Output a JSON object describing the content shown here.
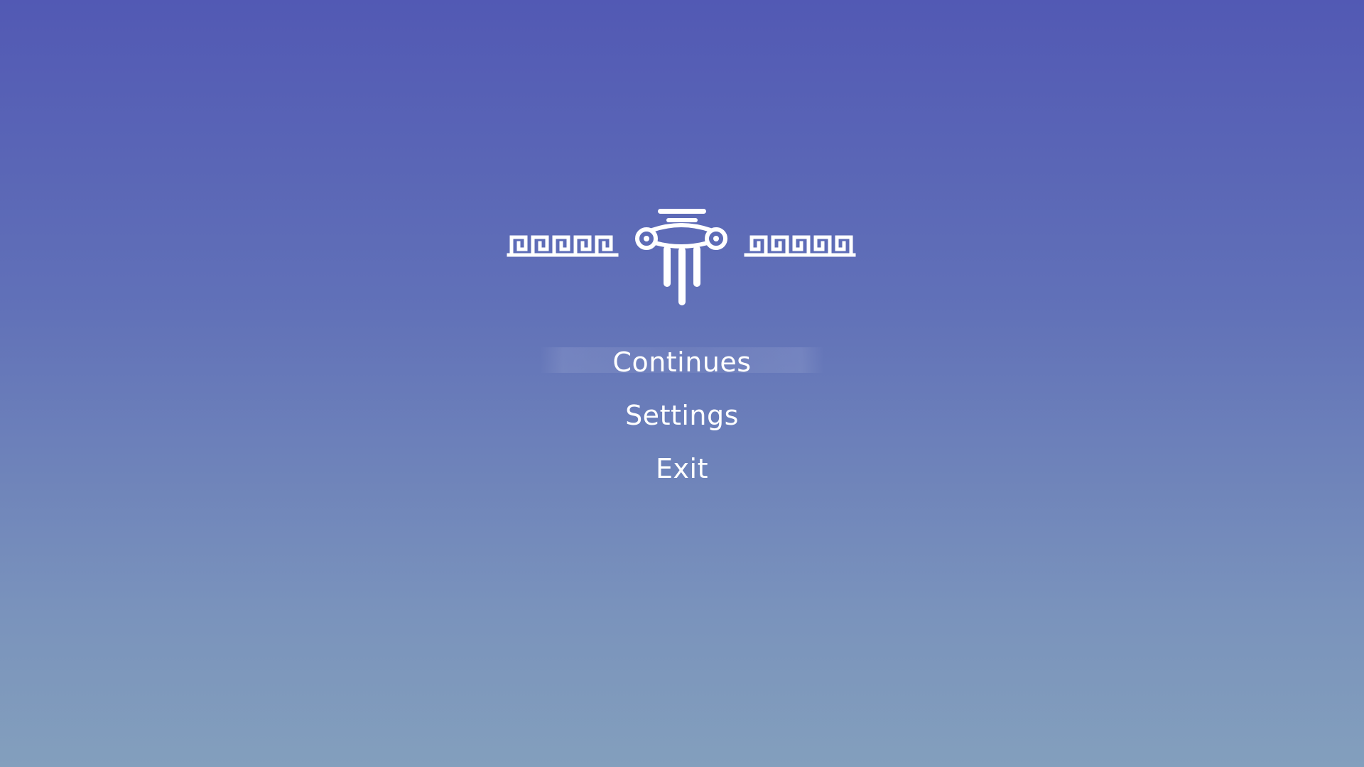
{
  "screen": "pause-menu",
  "colors": {
    "background_top": "#5259b4",
    "background_bottom": "#839fbd",
    "text": "#ffffff",
    "emblem": "#ffffff"
  },
  "emblem": {
    "icon": "ionic-column-with-greek-key-ornament-icon"
  },
  "menu": {
    "selected_index": 0,
    "items": [
      {
        "label": "Continues"
      },
      {
        "label": "Settings"
      },
      {
        "label": "Exit"
      }
    ]
  }
}
